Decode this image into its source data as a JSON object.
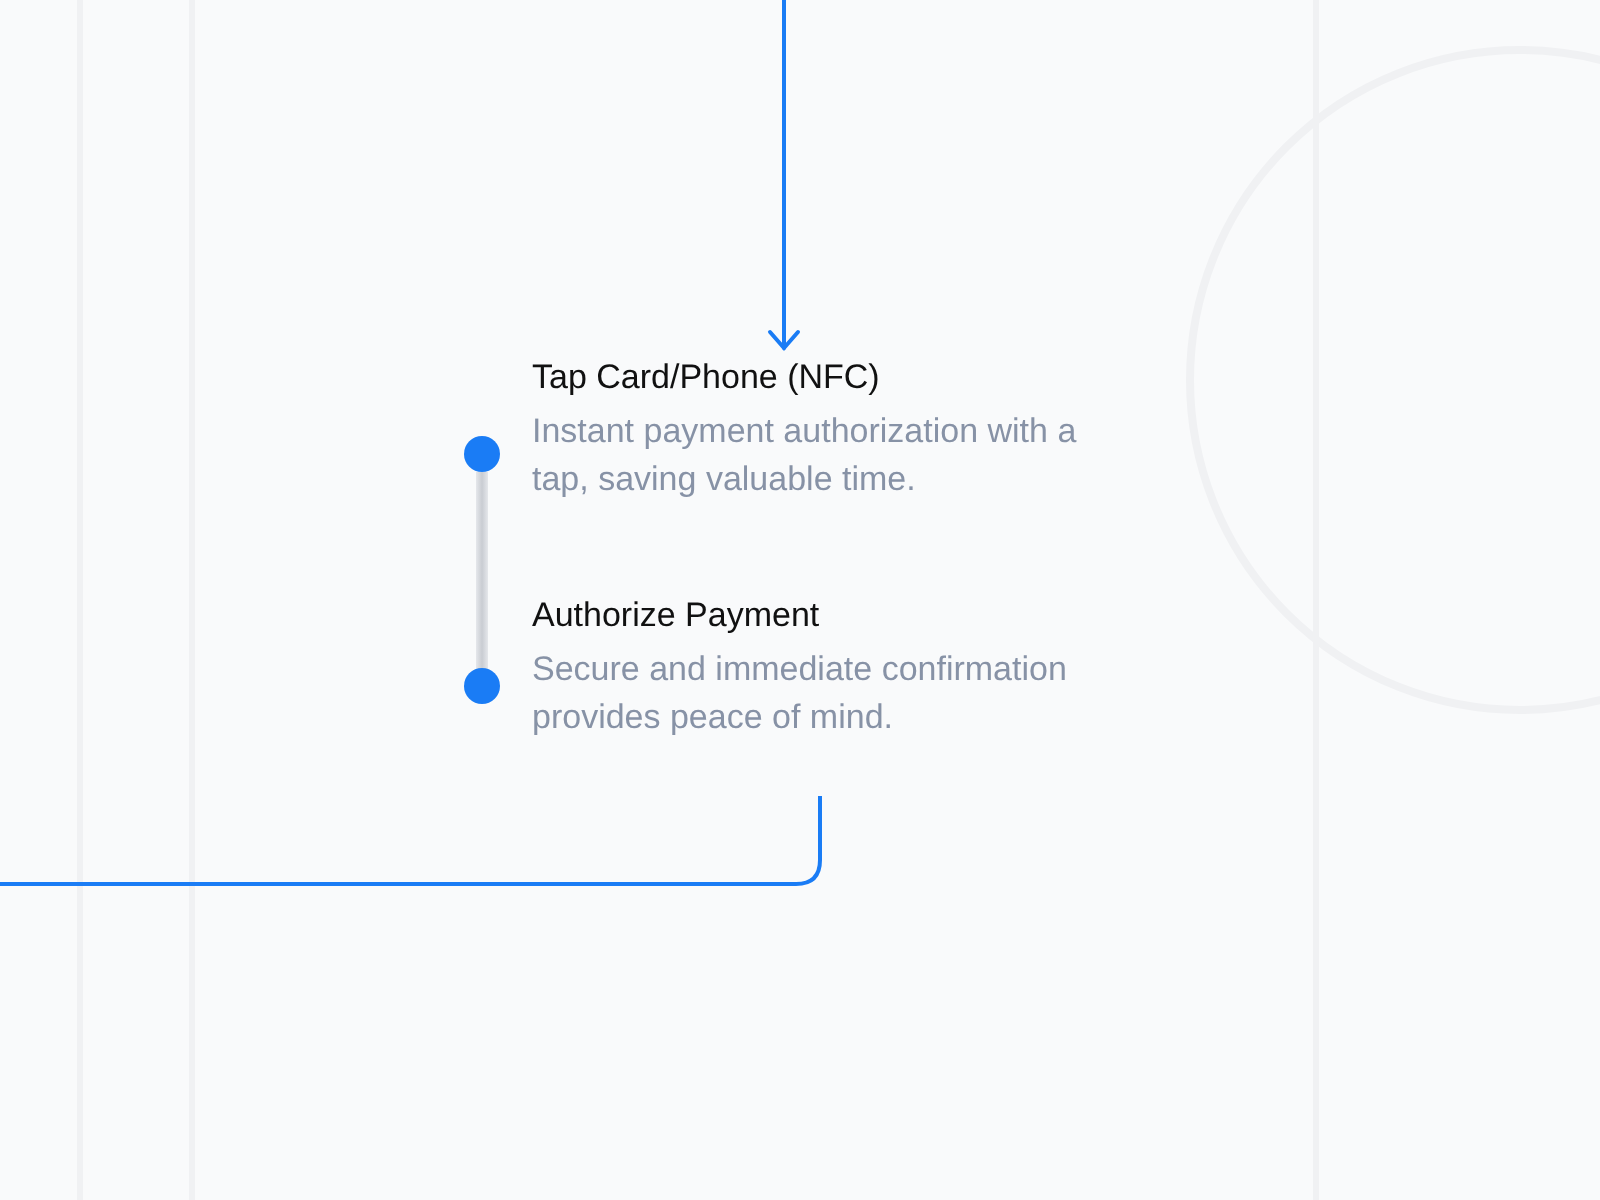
{
  "steps": [
    {
      "title": "Tap Card/Phone (NFC)",
      "description": "Instant payment authorization with a tap, saving valuable time."
    },
    {
      "title": "Authorize Payment",
      "description": "Secure and immediate confirmation provides peace of mind."
    }
  ]
}
